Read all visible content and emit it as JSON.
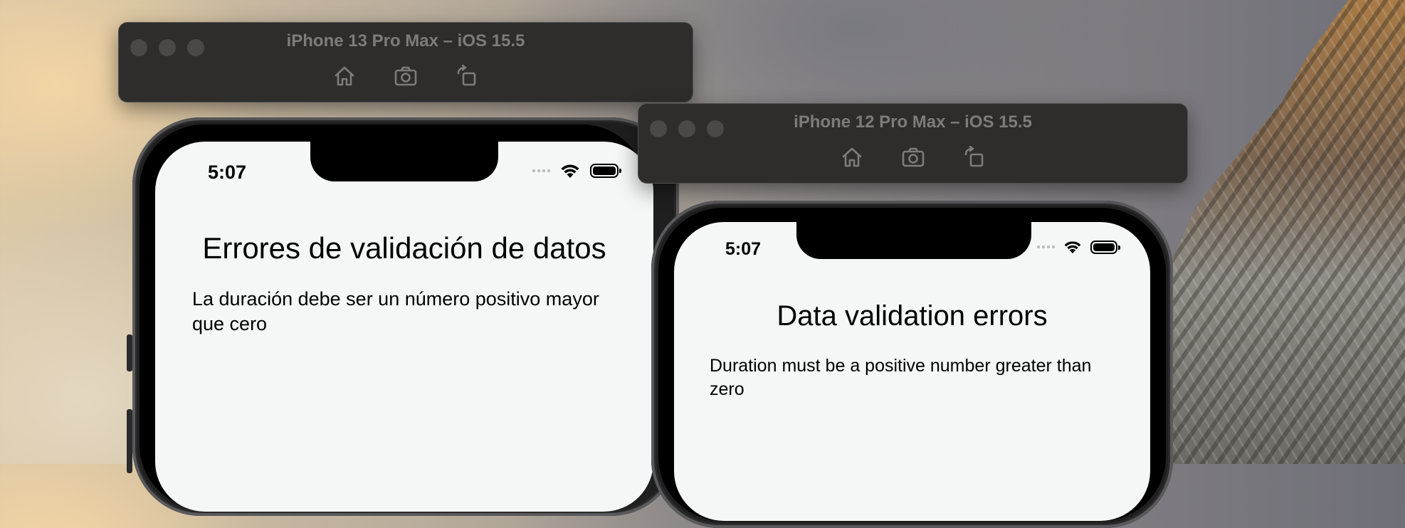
{
  "windows": [
    {
      "id": "iphone13",
      "title": "iPhone 13 Pro Max – iOS 15.5",
      "toolbar": [
        {
          "name": "home-icon"
        },
        {
          "name": "screenshot-camera-icon"
        },
        {
          "name": "rotate-icon"
        }
      ],
      "status": {
        "time": "5:07",
        "icons": [
          "cellular-signal-icon",
          "wifi-icon",
          "battery-icon"
        ]
      },
      "heading": "Errores de validación de datos",
      "message": "La duración debe ser un número positivo mayor que cero"
    },
    {
      "id": "iphone12",
      "title": "iPhone 12 Pro Max – iOS 15.5",
      "toolbar": [
        {
          "name": "home-icon"
        },
        {
          "name": "screenshot-camera-icon"
        },
        {
          "name": "rotate-icon"
        }
      ],
      "status": {
        "time": "5:07",
        "icons": [
          "cellular-signal-icon",
          "wifi-icon",
          "battery-icon"
        ]
      },
      "heading": "Data validation errors",
      "message": "Duration must be a positive number greater than zero"
    }
  ],
  "colors": {
    "window_chrome": "#2e2d2c",
    "window_title": "#7d7c7a",
    "screen_background": "#f5f6f6",
    "text": "#000000"
  }
}
